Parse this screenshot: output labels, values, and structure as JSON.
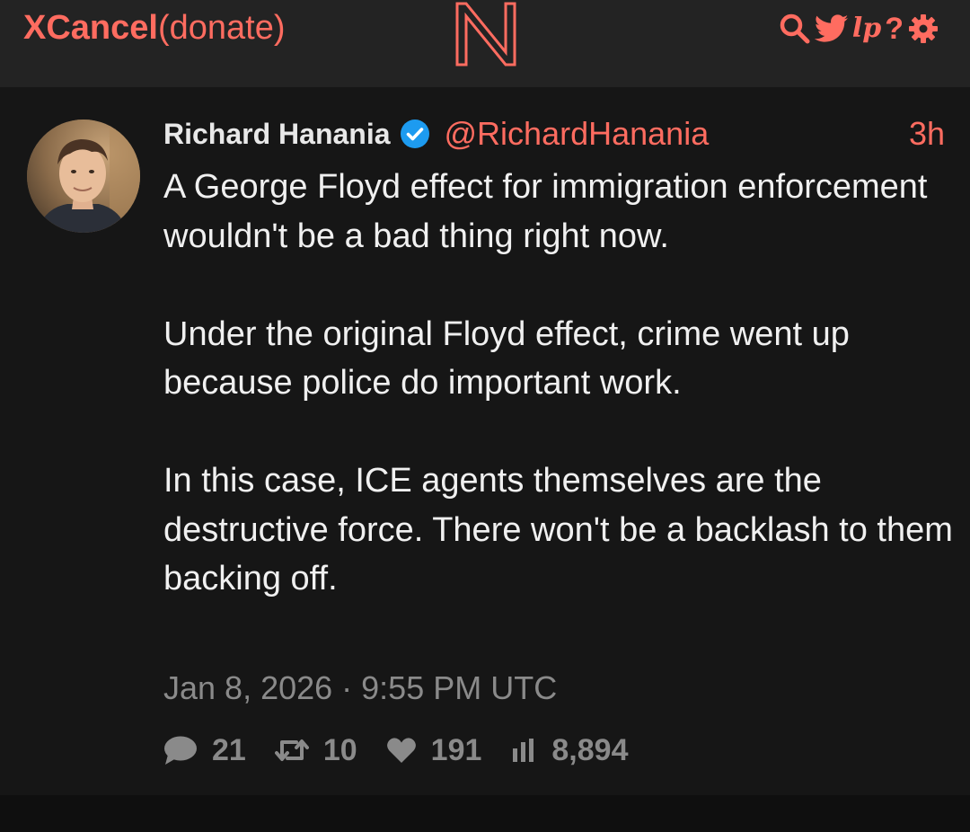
{
  "navbar": {
    "brand_name": "XCancel",
    "brand_donate": "(donate)",
    "logo_letter": "N",
    "icons": [
      "search-icon",
      "twitter-bird-icon",
      "lp-text",
      "help-icon",
      "gear-icon"
    ],
    "lp_label": "lp",
    "help_label": "?"
  },
  "tweet": {
    "fullname": "Richard Hanania",
    "username": "@RichardHanania",
    "age": "3h",
    "verified": true,
    "content": "A George Floyd effect for immigration enforcement wouldn't be a bad thing right now.\n\nUnder the original Floyd effect, crime went up because police do important work.\n\nIn this case, ICE agents themselves are the destructive force. There won't be a backlash to them backing off.",
    "date": "Jan 8, 2026 · 9:55 PM UTC",
    "stats": {
      "replies": "21",
      "retweets": "10",
      "likes": "191",
      "views": "8,894"
    }
  },
  "colors": {
    "accent": "#ff6c60",
    "navbar_bg": "#232323",
    "tweet_bg": "#161616",
    "page_bg": "#0f0f0f",
    "text": "#f0f0f0",
    "muted": "#8a8a8a",
    "verified_blue": "#1d9bf0"
  }
}
